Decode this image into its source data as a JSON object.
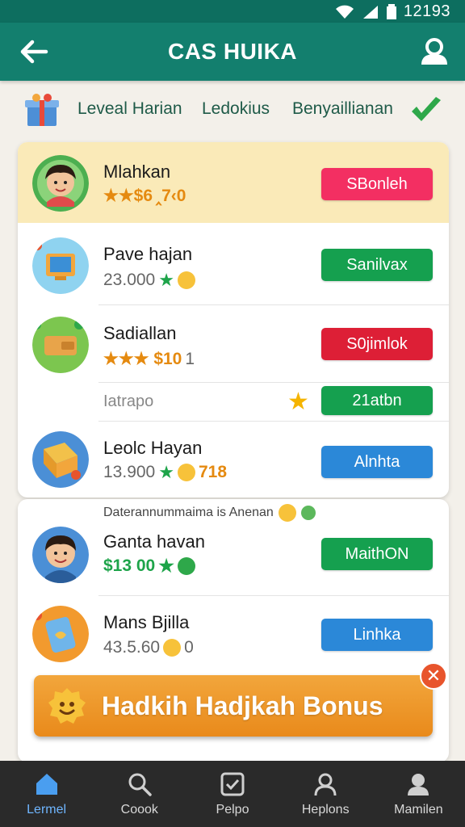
{
  "status_bar": {
    "time": "12193"
  },
  "app_bar": {
    "title": "CAS HUIKA"
  },
  "filters": {
    "tabs": [
      "Leveal Harian",
      "Ledokius",
      "Benyaillianan"
    ]
  },
  "list": {
    "rows": [
      {
        "title": "Mlahkan",
        "sub": "★★$6",
        "sub2": "‸7‹0",
        "button": "SBonleh",
        "button_color": "#f32f62"
      },
      {
        "title": "Pave hajan",
        "sub": "23.000",
        "button": "Sanilvax",
        "button_color": "#15a04f"
      },
      {
        "title": "Sadiallan",
        "sub": "★★★ $10",
        "sub2": "1",
        "button": "S0jimlok",
        "button_color": "#dd1f36"
      },
      {
        "title": "Iatrapo",
        "button": "21atbn",
        "button_color": "#15a04f"
      },
      {
        "title": "Leolc Hayan",
        "sub": "13.900",
        "sub2": "718",
        "button": "Alnhta",
        "button_color": "#2b88d8"
      }
    ]
  },
  "list2": {
    "note": "Daterannummaima is Anenan",
    "rows": [
      {
        "title": "Ganta havan",
        "sub": "$13 00",
        "button": "MaithON",
        "button_color": "#15a04f"
      },
      {
        "title": "Mans Bjilla",
        "sub": "43.5.60",
        "sub2": "0",
        "button": "Linhka",
        "button_color": "#2b88d8"
      }
    ]
  },
  "bonus": {
    "text": "Hadkih Hadjkah Bonus",
    "close_glyph": "✕"
  },
  "bottom_nav": {
    "items": [
      {
        "label": "Lermel",
        "icon": "home-icon",
        "active": true
      },
      {
        "label": "Coook",
        "icon": "search-icon",
        "active": false
      },
      {
        "label": "Pelpo",
        "icon": "checkbox-icon",
        "active": false
      },
      {
        "label": "Heplons",
        "icon": "person-icon",
        "active": false
      },
      {
        "label": "Mamilen",
        "icon": "profile-icon",
        "active": false
      }
    ]
  }
}
